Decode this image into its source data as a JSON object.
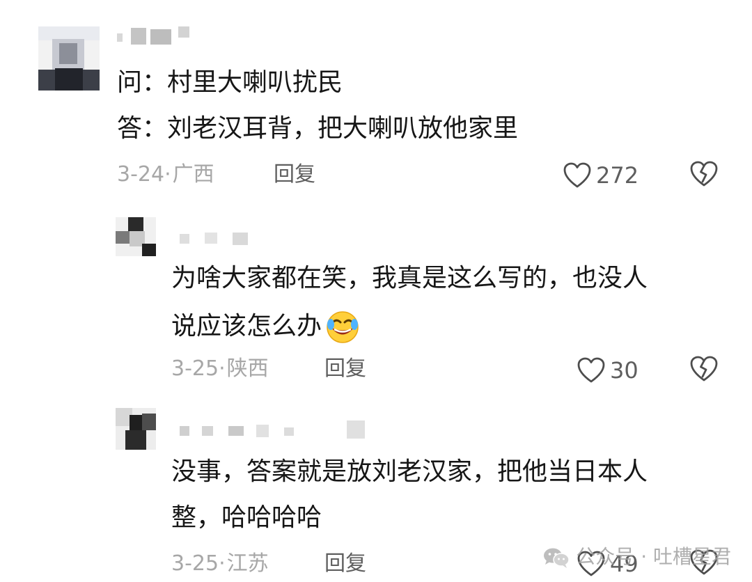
{
  "comments": [
    {
      "lines": [
        "问：村里大喇叭扰民",
        "答：刘老汉耳背，把大喇叭放他家里"
      ],
      "date": "3-24·",
      "location": "广西",
      "reply_label": "回复",
      "likes": "272"
    },
    {
      "lines": [
        "为啥大家都在笑，我真是这么写的，也没人",
        "说应该怎么办"
      ],
      "emoji": "rofl-emoji",
      "date": "3-25·",
      "location": "陕西",
      "reply_label": "回复",
      "likes": "30"
    },
    {
      "lines": [
        "没事，答案就是放刘老汉家，把他当日本人",
        "整，哈哈哈哈"
      ],
      "date": "3-25·",
      "location": "江苏",
      "reply_label": "回复",
      "likes": "49"
    }
  ],
  "watermark": {
    "icon": "wechat-icon",
    "text": "公众号 · 吐槽星君"
  },
  "colors": {
    "text": "#161616",
    "meta": "#a7a7a7",
    "action": "#5e5e5e",
    "background": "#ffffff"
  }
}
